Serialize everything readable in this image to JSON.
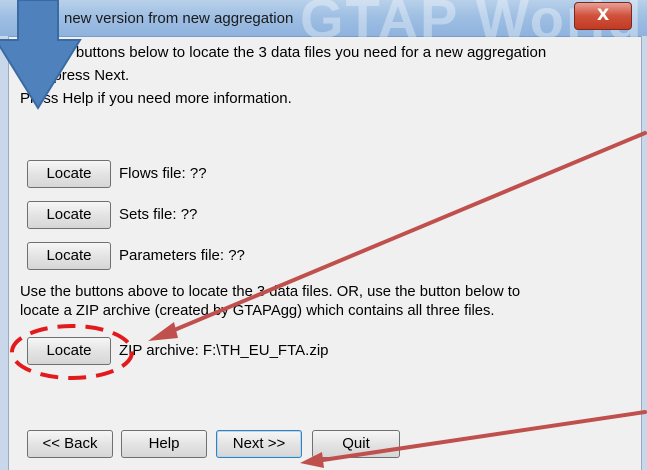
{
  "window": {
    "title": "new version from new aggregation",
    "background_text": "GTAP World",
    "close_label": "X"
  },
  "instructions": {
    "line1": "Use the buttons below to locate the 3 data files you need for a new aggregation",
    "line2": "then press Next.",
    "line3": "Press Help if you need more information."
  },
  "files": [
    {
      "button": "Locate",
      "label": "Flows file: ??"
    },
    {
      "button": "Locate",
      "label": "Sets file: ??"
    },
    {
      "button": "Locate",
      "label": "Parameters file: ??"
    }
  ],
  "alt_text": {
    "line1": "Use the buttons above to locate the 3 data files. OR, use the button below to",
    "line2": "locate a ZIP archive (created by GTAPAgg) which contains all three files."
  },
  "zip": {
    "button": "Locate",
    "label": "ZIP archive: F:\\TH_EU_FTA.zip"
  },
  "nav": {
    "back": "<< Back",
    "help": "Help",
    "next": "Next >>",
    "quit": "Quit"
  },
  "colors": {
    "annotation_arrow": "#c0504d",
    "big_arrow": "#4f81bd",
    "dashed_ellipse": "#e31a1c"
  }
}
